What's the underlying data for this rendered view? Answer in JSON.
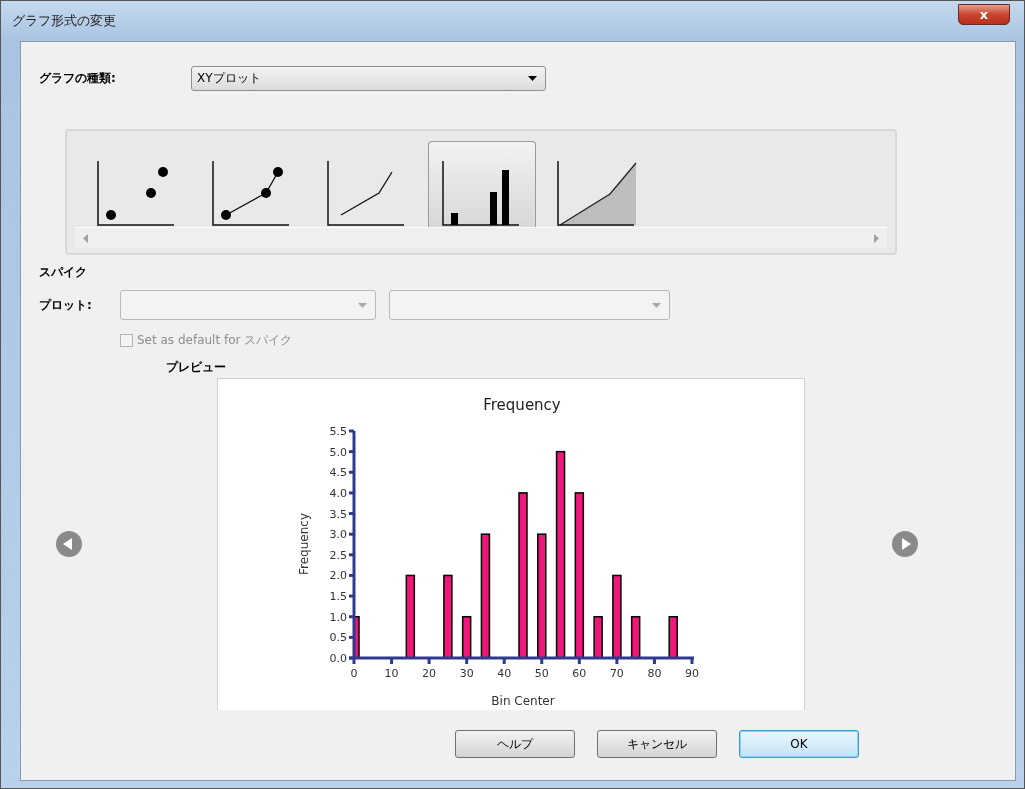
{
  "window": {
    "title": "グラフ形式の変更",
    "close": "x"
  },
  "graph_type": {
    "label": "グラフの種類:",
    "value": "XYプロット"
  },
  "gallery": [
    {
      "kind": "scatter",
      "selected": false
    },
    {
      "kind": "line-scatter",
      "selected": false
    },
    {
      "kind": "line",
      "selected": false
    },
    {
      "kind": "bar",
      "selected": true
    },
    {
      "kind": "area",
      "selected": false
    }
  ],
  "section_title": "スパイク",
  "plot": {
    "label": "プロット:",
    "disabled": true
  },
  "default_checkbox": {
    "label": "Set as default for スパイク",
    "checked": false,
    "disabled": true
  },
  "preview": {
    "label": "プレビュー",
    "chart_data": {
      "type": "bar",
      "title": "Frequency",
      "xlabel": "Bin Center",
      "ylabel": "Frequency",
      "x": [
        0,
        15,
        25,
        30,
        35,
        45,
        50,
        55,
        60,
        65,
        70,
        75,
        85
      ],
      "values": [
        1,
        2,
        2,
        1,
        3,
        4,
        3,
        5,
        4,
        1,
        2,
        1,
        1
      ],
      "xlim": [
        0,
        90
      ],
      "ylim": [
        0,
        5.5
      ],
      "xticks": [
        0,
        10,
        20,
        30,
        40,
        50,
        60,
        70,
        80,
        90
      ],
      "yticks": [
        {
          "value": 0,
          "label": "0.0"
        },
        {
          "value": 0.5,
          "label": "0.5"
        },
        {
          "value": 1,
          "label": "1.0"
        },
        {
          "value": 1.5,
          "label": "1.5"
        },
        {
          "value": 2,
          "label": "2.0"
        },
        {
          "value": 2.5,
          "label": "2.5"
        },
        {
          "value": 3,
          "label": "3.0"
        },
        {
          "value": 3.5,
          "label": "3.5"
        },
        {
          "value": 4,
          "label": "4.0"
        },
        {
          "value": 4.5,
          "label": "4.5"
        },
        {
          "value": 5,
          "label": "5.0"
        },
        {
          "value": 5.5,
          "label": "5.5"
        }
      ]
    }
  },
  "buttons": [
    {
      "label": "ヘルプ",
      "default": false
    },
    {
      "label": "キャンセル",
      "default": false
    },
    {
      "label": "OK",
      "default": true
    }
  ]
}
